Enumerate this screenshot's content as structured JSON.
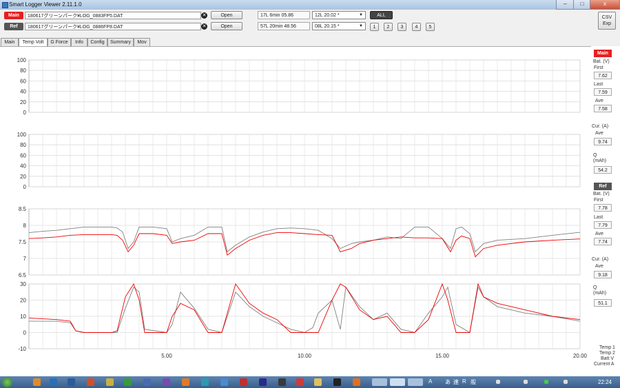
{
  "window": {
    "title": "Smart Logger Viewer 2.11.1.0",
    "minimize": "–",
    "maximize": "□",
    "close": "x"
  },
  "files": {
    "main": {
      "tag": "Main",
      "path": "180617グリーンパーク¥LOG_0883FP5.DAT",
      "open_label": "Open",
      "info": "17L  6min 05.86",
      "selected_lap": "12L  20.02 *"
    },
    "ref": {
      "tag": "Ref",
      "path": "180617グリーンパーク¥LOG_0886FP8.DAT",
      "open_label": "Open",
      "info": "57L  20min 48.56",
      "selected_lap": "08L  20.15 *"
    },
    "all_label": "ALL",
    "number_buttons": [
      "1",
      "2",
      "3",
      "4",
      "5"
    ],
    "csv_label": "CSV\nExp"
  },
  "tabs": [
    "Main",
    "Temp Volt",
    "G Force",
    "Info",
    "Config",
    "Summary",
    "Mov"
  ],
  "active_tab": "Temp Volt",
  "side_panel": {
    "main": {
      "badge": "Main",
      "bat_label": "Bat. (V)",
      "first_label": "First",
      "first": "7.62",
      "last_label": "Last",
      "last": "7.59",
      "ave_label": "Ave",
      "ave": "7.58",
      "cur_label": "Cur. (A)",
      "cur_ave_label": "Ave",
      "cur_ave": "9.74",
      "q_label": "Q\n(mAh)",
      "q": "54.2"
    },
    "ref": {
      "badge": "Ref",
      "bat_label": "Bat. (V)",
      "first_label": "First",
      "first": "7.78",
      "last_label": "Last",
      "last": "7.79",
      "ave_label": "Ave",
      "ave": "7.74",
      "cur_label": "Cur. (A)",
      "cur_ave_label": "Ave",
      "cur_ave": "9.18",
      "q_label": "Q\n(mAh)",
      "q": "51.1"
    },
    "legend": [
      "Temp 1",
      "Temp 2",
      "Batt V",
      "Current A"
    ]
  },
  "colors": {
    "main": "#ee0000",
    "ref": "#808080",
    "badge_main": "#e62020",
    "badge_ref": "#555555"
  },
  "chart_data": [
    {
      "type": "line",
      "panel": "temp1",
      "ylim": [
        0,
        100
      ],
      "yticks": [
        "100",
        "80",
        "60",
        "40",
        "20",
        "0"
      ],
      "grid": true,
      "series": []
    },
    {
      "type": "line",
      "panel": "temp2",
      "ylim": [
        0,
        100
      ],
      "yticks": [
        "100",
        "80",
        "60",
        "40",
        "20",
        "0"
      ],
      "grid": true,
      "series": []
    },
    {
      "type": "line",
      "panel": "battery_voltage",
      "ylim": [
        6.5,
        8.5
      ],
      "yticks": [
        "8.5",
        "8",
        "7.5",
        "7",
        "6.5"
      ],
      "grid": true,
      "x": [
        0,
        0.5,
        1,
        1.5,
        2,
        2.5,
        3,
        3.2,
        3.4,
        3.6,
        3.8,
        4,
        4.5,
        5,
        5.2,
        5.5,
        6,
        6.5,
        7,
        7.2,
        7.5,
        8,
        8.5,
        9,
        9.5,
        10,
        10.5,
        11,
        11.3,
        11.7,
        12,
        12.5,
        13,
        13.5,
        14,
        14.5,
        15,
        15.3,
        15.5,
        15.7,
        16,
        16.2,
        16.5,
        17,
        18,
        19,
        20
      ],
      "series": [
        {
          "color": "#ee0000",
          "values": [
            7.6,
            7.62,
            7.65,
            7.7,
            7.72,
            7.72,
            7.72,
            7.7,
            7.55,
            7.2,
            7.4,
            7.75,
            7.75,
            7.7,
            7.45,
            7.5,
            7.55,
            7.75,
            7.75,
            7.1,
            7.3,
            7.55,
            7.7,
            7.78,
            7.78,
            7.75,
            7.72,
            7.7,
            7.2,
            7.3,
            7.45,
            7.55,
            7.6,
            7.65,
            7.62,
            7.62,
            7.6,
            7.2,
            7.55,
            7.68,
            7.6,
            7.05,
            7.3,
            7.4,
            7.5,
            7.55,
            7.59
          ]
        },
        {
          "color": "#808080",
          "values": [
            7.78,
            7.82,
            7.85,
            7.9,
            7.95,
            7.95,
            7.95,
            7.92,
            7.8,
            7.3,
            7.5,
            7.95,
            7.95,
            7.9,
            7.5,
            7.6,
            7.7,
            7.95,
            7.95,
            7.2,
            7.4,
            7.65,
            7.8,
            7.9,
            7.92,
            7.9,
            7.85,
            7.6,
            7.3,
            7.45,
            7.5,
            7.55,
            7.65,
            7.6,
            7.95,
            7.95,
            7.6,
            7.3,
            7.9,
            7.95,
            7.75,
            7.2,
            7.45,
            7.55,
            7.6,
            7.7,
            7.79
          ]
        }
      ]
    },
    {
      "type": "line",
      "panel": "current",
      "ylim": [
        -10,
        30
      ],
      "yticks": [
        "30",
        "20",
        "10",
        "0",
        "-10"
      ],
      "xticks": [
        "5.00",
        "10.00",
        "15.00",
        "20.00"
      ],
      "xlim": [
        0,
        20
      ],
      "grid": true,
      "x": [
        0,
        1,
        1.5,
        1.7,
        2,
        3,
        3.2,
        3.5,
        3.8,
        4,
        4.2,
        5,
        5.2,
        5.5,
        6,
        6.5,
        7,
        7.5,
        8,
        8.5,
        9,
        9.5,
        10,
        10.3,
        10.5,
        11,
        11.3,
        11.5,
        12,
        12.5,
        13,
        13.5,
        14,
        14.5,
        15,
        15.2,
        15.5,
        16,
        16.3,
        16.5,
        17,
        18,
        19,
        20
      ],
      "series": [
        {
          "color": "#ee0000",
          "values": [
            9,
            8,
            7,
            1,
            0,
            0,
            1,
            22,
            30,
            20,
            0,
            0,
            10,
            18,
            14,
            0,
            0,
            30,
            18,
            12,
            8,
            0,
            0,
            0,
            0,
            20,
            30,
            28,
            14,
            8,
            10,
            0,
            0,
            8,
            30,
            20,
            0,
            0,
            30,
            22,
            18,
            14,
            10,
            8
          ]
        },
        {
          "color": "#808080",
          "values": [
            7,
            7,
            6,
            1,
            0,
            0,
            0,
            15,
            28,
            25,
            2,
            0,
            5,
            25,
            15,
            2,
            0,
            25,
            16,
            10,
            6,
            2,
            0,
            3,
            12,
            20,
            2,
            28,
            16,
            8,
            12,
            2,
            0,
            12,
            22,
            28,
            5,
            0,
            28,
            22,
            16,
            12,
            10,
            7
          ]
        }
      ]
    }
  ],
  "taskbar": {
    "clock": "22:24",
    "ime": [
      "A",
      "あ",
      "連",
      "R",
      "般"
    ]
  }
}
